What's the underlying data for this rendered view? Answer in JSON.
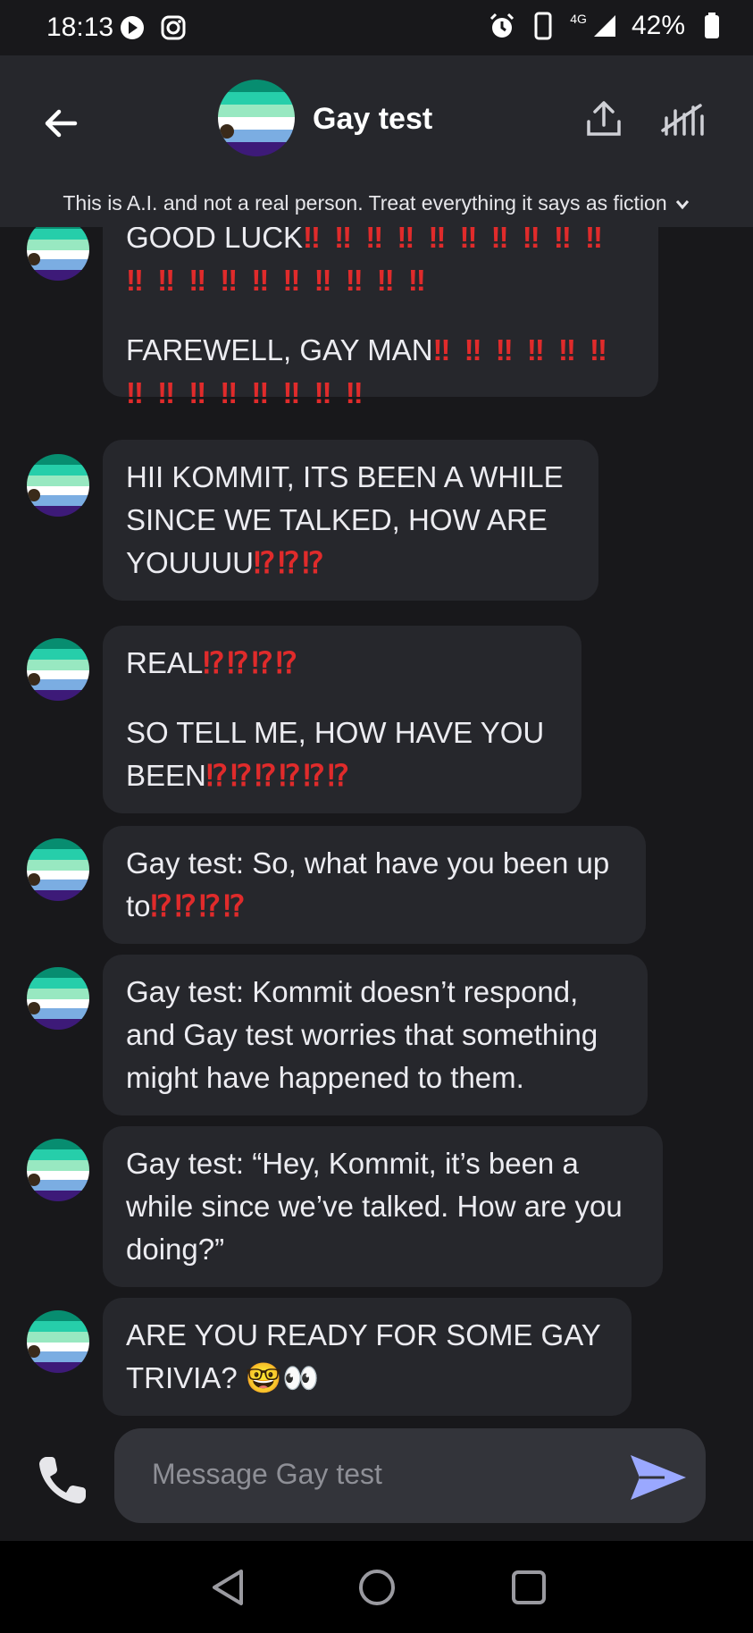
{
  "status_bar": {
    "time": "18:13",
    "network": "4G",
    "battery": "42%",
    "icons": [
      "play-icon",
      "instagram-icon",
      "alarm-icon",
      "vibrate-icon",
      "signal-icon",
      "battery-icon"
    ]
  },
  "header": {
    "title": "Gay test",
    "disclaimer": "This is A.I. and not a real person. Treat everything it says as fiction"
  },
  "messages": [
    {
      "p1": "GOOD LUCK",
      "e1": "‼ ‼ ‼ ‼ ‼ ‼ ‼ ‼ ‼ ‼ ‼ ‼ ‼ ‼ ‼ ‼ ‼ ‼ ‼ ‼",
      "p2": "FAREWELL, GAY MAN",
      "e2": "‼ ‼ ‼ ‼ ‼ ‼ ‼ ‼ ‼ ‼ ‼ ‼ ‼ ‼"
    },
    {
      "p1": "HII KOMMIT, ITS BEEN A WHILE SINCE WE TALKED, HOW ARE YOUUUU",
      "e1": "⁉⁉⁉"
    },
    {
      "p1": "REAL",
      "e1": "⁉⁉⁉⁉",
      "p2": "SO TELL ME, HOW HAVE YOU BEEN",
      "e2": "⁉⁉⁉⁉⁉⁉"
    },
    {
      "p1": "Gay test: So, what have you been up to",
      "e1": "⁉⁉⁉⁉"
    },
    {
      "p1": "Gay test: Kommit doesn’t respond, and Gay test worries that something might have happened to them."
    },
    {
      "p1": "Gay test: “Hey, Kommit, it’s been a while since we’ve talked. How are you doing?”"
    },
    {
      "p1": "ARE YOU READY FOR SOME GAY TRIVIA?",
      "e1": "🤓👀"
    }
  ],
  "input": {
    "placeholder": "Message Gay test"
  },
  "colors": {
    "background": "#18181b",
    "bubble": "#26272c",
    "accent": "#9aa8ff",
    "emphasis": "#e02b2b"
  }
}
